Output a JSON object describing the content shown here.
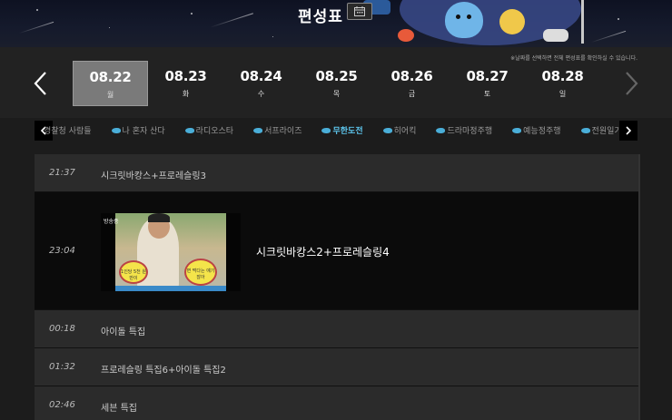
{
  "header": {
    "title": "편성표"
  },
  "datebar": {
    "note": "※날짜를 선택하면 전체 편성표를 확인하실 수 있습니다.",
    "dates": [
      {
        "date": "08.22",
        "weekday": "월",
        "active": true
      },
      {
        "date": "08.23",
        "weekday": "화",
        "active": false
      },
      {
        "date": "08.24",
        "weekday": "수",
        "active": false
      },
      {
        "date": "08.25",
        "weekday": "목",
        "active": false
      },
      {
        "date": "08.26",
        "weekday": "금",
        "active": false
      },
      {
        "date": "08.27",
        "weekday": "토",
        "active": false
      },
      {
        "date": "08.28",
        "weekday": "일",
        "active": false
      }
    ]
  },
  "tabs": [
    {
      "label": "경찰청 사람들",
      "active": false
    },
    {
      "label": "나 혼자 산다",
      "active": false
    },
    {
      "label": "라디오스타",
      "active": false
    },
    {
      "label": "서프라이즈",
      "active": false
    },
    {
      "label": "무한도전",
      "active": true
    },
    {
      "label": "히어킥",
      "active": false
    },
    {
      "label": "드라마정주행",
      "active": false
    },
    {
      "label": "예능정주행",
      "active": false
    },
    {
      "label": "전원일기",
      "active": false
    }
  ],
  "schedule": [
    {
      "time": "21:37",
      "program": "시크릿바캉스+프로레슬링3"
    },
    {
      "time": "23:04",
      "program": "시크릿바캉스2+프로레슬링4",
      "thumb_logo": "방송중",
      "bubble_left": "1인당 5천 원 만이",
      "bubble_right": "면 먹다는 얘기잖아"
    },
    {
      "time": "00:18",
      "program": "아이돌 특집"
    },
    {
      "time": "01:32",
      "program": "프로레슬링 특집6+아이돌 특집2"
    },
    {
      "time": "02:46",
      "program": "세븐 특집"
    }
  ],
  "colors": {
    "active_tab": "#5ec8f0",
    "active_date_bg": "#7a7a7a",
    "row_bg": "#2b2b2b",
    "feature_bg": "#0b0b0b"
  }
}
